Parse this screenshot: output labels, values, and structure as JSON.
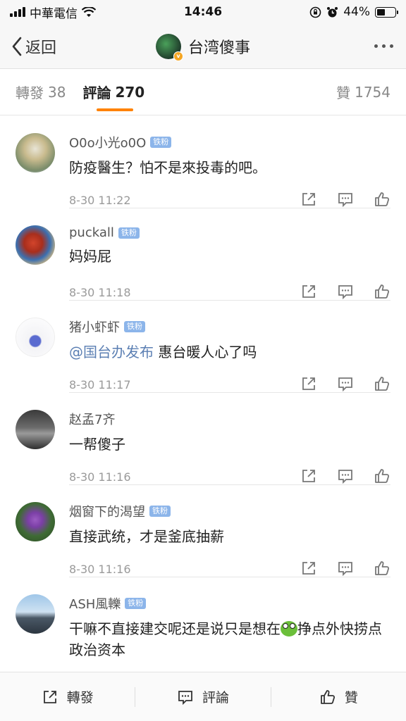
{
  "status_bar": {
    "carrier": "中華電信",
    "time": "14:46",
    "battery": "44%",
    "battery_level": 0.44
  },
  "nav": {
    "back_label": "返回",
    "title": "台湾傻事"
  },
  "tabs": {
    "repost_label": "轉發",
    "repost_count": "38",
    "comment_label": "評論",
    "comment_count": "270",
    "like_label": "贊",
    "like_count": "1754"
  },
  "comments": [
    {
      "user": "O0o小光o0O",
      "badge": "铁粉",
      "text": "防疫醫生？怕不是來投毒的吧。",
      "time": "8-30 11:22"
    },
    {
      "user": "puckall",
      "badge": "铁粉",
      "text": "妈妈屁",
      "time": "8-30 11:18"
    },
    {
      "user": "猪小虾虾",
      "badge": "铁粉",
      "mention": "@国台办发布",
      "text": " 惠台暖人心了吗",
      "time": "8-30 11:17"
    },
    {
      "user": "赵孟7齐",
      "badge": "",
      "text": "一帮傻子",
      "time": "8-30 11:16"
    },
    {
      "user": "烟窗下的渴望",
      "badge": "铁粉",
      "text": "直接武统，才是釜底抽薪",
      "time": "8-30 11:16"
    },
    {
      "user": "ASH風轢",
      "badge": "铁粉",
      "text_before": "干嘛不直接建交呢还是说只是想在",
      "text_after": "挣点外快捞点政治资本",
      "time": ""
    }
  ],
  "bottom_bar": {
    "repost": "轉發",
    "comment": "評論",
    "like": "贊"
  },
  "colors": {
    "accent": "#ff8200",
    "badge": "#8cb5ea",
    "mention": "#5b7fb3"
  }
}
